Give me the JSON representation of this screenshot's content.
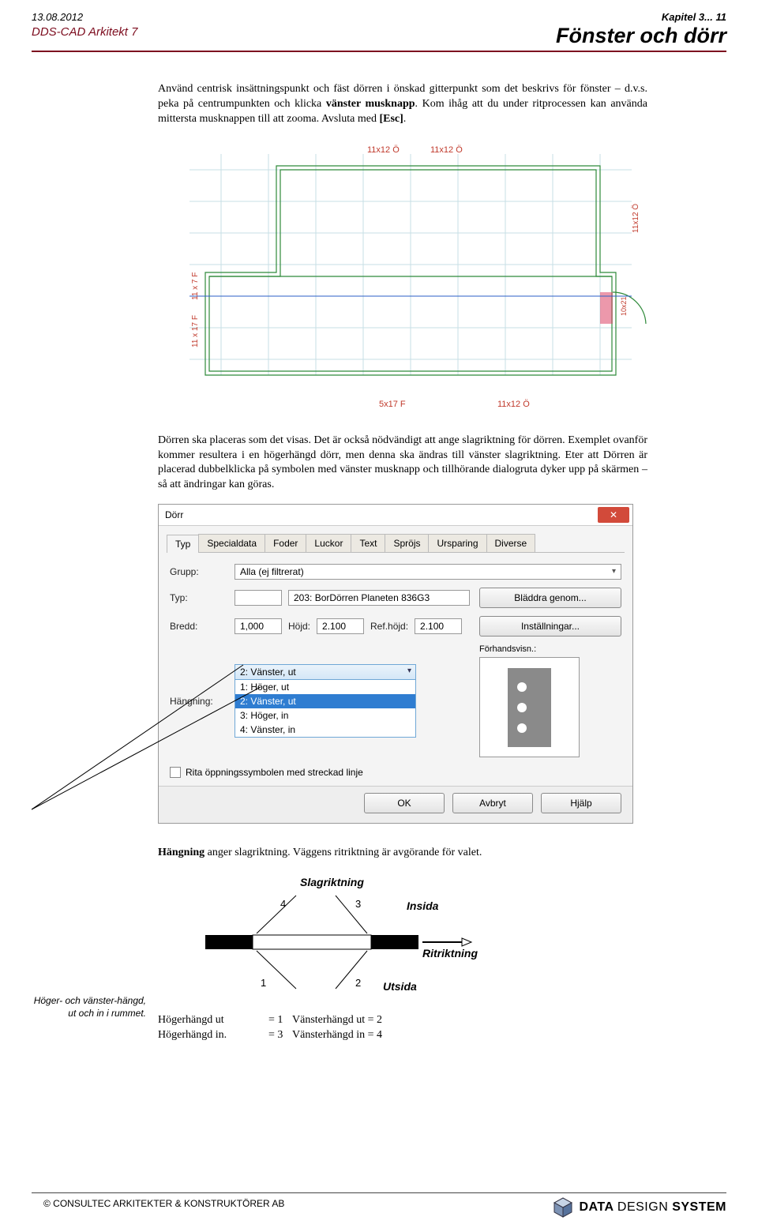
{
  "header": {
    "date": "13.08.2012",
    "app": "DDS-CAD Arkitekt 7",
    "chapter": "Kapitel 3... 11",
    "title": "Fönster och dörr"
  },
  "paragraphs": {
    "p1_a": "Använd centrisk insättningspunkt och fäst dörren i önskad gitterpunkt som det beskrivs för fönster – d.v.s. peka på centrumpunkten och klicka ",
    "p1_b": "vänster musknapp",
    "p1_c": ". Kom ihåg att du under ritprocessen kan använda mittersta musknappen till att zooma. Avsluta med ",
    "p1_d": "[Esc]",
    "p1_e": ".",
    "p2": "Dörren ska placeras som det visas. Det är också nödvändigt att ange slagriktning för dörren. Exemplet ovanför kommer resultera i en högerhängd dörr, men denna ska ändras till vänster slagriktning. Eter att Dörren är placerad dubbelklicka på symbolen med vänster musknapp och tillhörande dialogruta dyker upp på skärmen – så att ändringar kan göras.",
    "p3_a": "Hängning",
    "p3_b": " anger slagriktning. Väggens ritriktning är avgörande för valet."
  },
  "plan": {
    "topLabelL": "11x12 Ö",
    "topLabelR": "11x12 Ö",
    "right": "11x12 Ö",
    "left1": "11 x 7 F",
    "left2": "11 x 17 F",
    "botC": "5x17 F",
    "botR": "11x12 Ö",
    "doorDim": "10x21"
  },
  "dialog": {
    "title": "Dörr",
    "tabs": [
      "Typ",
      "Specialdata",
      "Foder",
      "Luckor",
      "Text",
      "Spröjs",
      "Ursparing",
      "Diverse"
    ],
    "grupp_lbl": "Grupp:",
    "grupp_val": "Alla (ej filtrerat)",
    "typ_lbl": "Typ:",
    "typ_code": "",
    "typ_name": "203:  BorDörren Planeten 836G3",
    "browse": "Bläddra genom...",
    "settings": "Inställningar...",
    "bredd_lbl": "Bredd:",
    "bredd": "1,000",
    "hojd_lbl": "Höjd:",
    "hojd": "2.100",
    "refhojd_lbl": "Ref.höjd:",
    "refhojd": "2.100",
    "hang_lbl": "Hängning:",
    "hang_sel": "2: Vänster, ut",
    "hang_opts": [
      "1: Höger, ut",
      "2: Vänster, ut",
      "3: Höger, in",
      "4: Vänster, in"
    ],
    "preview_lbl": "Förhandsvisn.:",
    "checkbox": "Rita öppningssymbolen med streckad linje",
    "ok": "OK",
    "cancel": "Avbryt",
    "help": "Hjälp"
  },
  "margin_note": "Höger- och vänster-hängd, ut och in i rummet.",
  "slag": {
    "title": "Slagriktning",
    "inside": "Insida",
    "dir": "Ritriktning",
    "outside": "Utsida",
    "n1": "1",
    "n2": "2",
    "n3": "3",
    "n4": "4"
  },
  "table": {
    "r1a": "Högerhängd ut",
    "r1b": "= 1",
    "r1c": "Vänsterhängd ut = 2",
    "r2a": "Högerhängd in.",
    "r2b": "= 3",
    "r2c": "Vänsterhängd in = 4"
  },
  "footer": {
    "left": "©  CONSULTEC ARKITEKTER & KONSTRUKTÖRER AB",
    "brand_a": "DATA ",
    "brand_b": "DESIGN ",
    "brand_c": "SYSTEM"
  }
}
